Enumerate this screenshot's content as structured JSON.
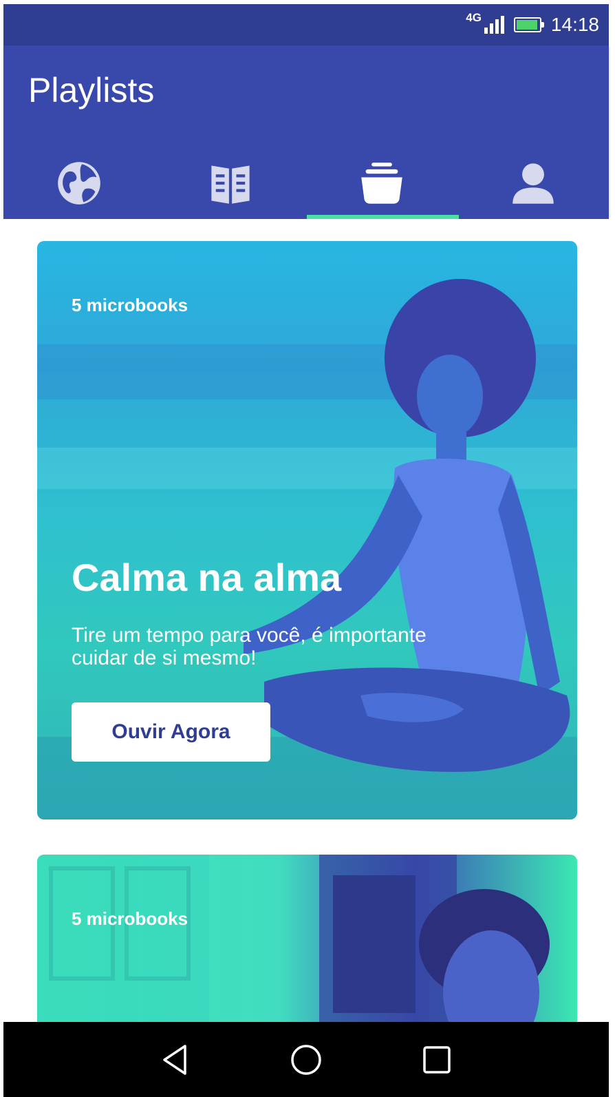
{
  "status_bar": {
    "network": "4G",
    "time": "14:18",
    "icons": [
      "signal-icon",
      "battery-charging-icon"
    ]
  },
  "app_bar": {
    "title": "Playlists",
    "tabs": [
      {
        "icon": "globe-icon",
        "selected": false
      },
      {
        "icon": "open-book-icon",
        "selected": false
      },
      {
        "icon": "stack-icon",
        "selected": true
      },
      {
        "icon": "user-icon",
        "selected": false
      }
    ],
    "indicator_color": "#4be0a4",
    "background_color": "#3949ab"
  },
  "playlists": [
    {
      "count": "5 microbooks",
      "title": "Calma na alma",
      "description": "Tire um tempo para você, é importante cuidar de si mesmo!",
      "button_label": "Ouvir Agora"
    },
    {
      "count": "5 microbooks"
    }
  ],
  "nav_bar": {
    "icons": [
      "back-icon",
      "home-icon",
      "recents-icon"
    ]
  }
}
